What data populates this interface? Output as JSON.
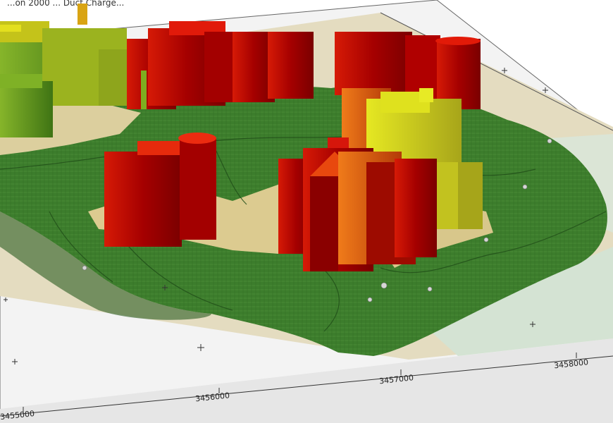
{
  "map": {
    "title_fragment": "...on 2000 ... Duct Charge...",
    "axis": {
      "x_ticks": [
        "3455000",
        "3456000",
        "3457000",
        "3458000"
      ]
    },
    "colors": {
      "background": "#ffffff",
      "frame": "#f2f2f2",
      "land_dark": "#2f6b25",
      "land": "#3d7f2e",
      "land_light": "#5b9a42",
      "built_area": "#d7c996",
      "water_area": "#cfdcc8",
      "bar_red": "#c00000",
      "bar_orange": "#e96a10",
      "bar_yellow": "#d7d60f",
      "bar_green": "#6aa31c"
    }
  }
}
